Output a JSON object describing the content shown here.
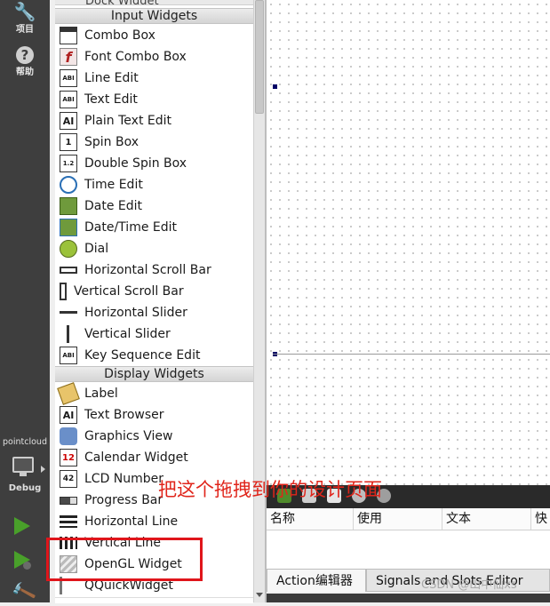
{
  "modebar": {
    "project_label": "项目",
    "help_label": "帮助",
    "kit_name": "pointcloud",
    "build_config": "Debug"
  },
  "widgetbox": {
    "top_partial": "Dock Widget",
    "input_category": "Input Widgets",
    "input_items": [
      "Combo Box",
      "Font Combo Box",
      "Line Edit",
      "Text Edit",
      "Plain Text Edit",
      "Spin Box",
      "Double Spin Box",
      "Time Edit",
      "Date Edit",
      "Date/Time Edit",
      "Dial",
      "Horizontal Scroll Bar",
      "Vertical Scroll Bar",
      "Horizontal Slider",
      "Vertical Slider",
      "Key Sequence Edit"
    ],
    "display_category": "Display Widgets",
    "display_items": [
      "Label",
      "Text Browser",
      "Graphics View",
      "Calendar Widget",
      "LCD Number",
      "Progress Bar",
      "Horizontal Line",
      "Vertical Line",
      "OpenGL Widget",
      "QQuickWidget"
    ]
  },
  "action_editor": {
    "columns": [
      "名称",
      "使用",
      "文本",
      "快"
    ],
    "tabs": [
      "Action编辑器",
      "Signals and Slots Editor"
    ]
  },
  "annotation": {
    "instruction": "把这个拖拽到你的设计页面",
    "highlight_color": "#e0151b"
  },
  "watermark": "CSDN @山中仙xs"
}
